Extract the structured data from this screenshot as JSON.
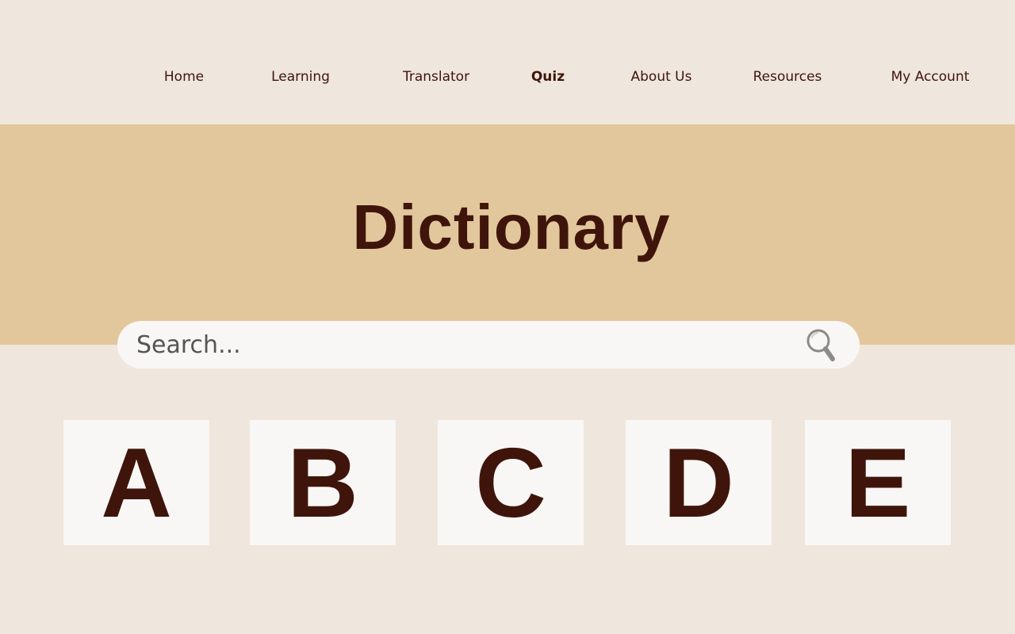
{
  "nav": {
    "items": [
      {
        "label": "Home",
        "active": false
      },
      {
        "label": "Learning",
        "active": false
      },
      {
        "label": "Translator",
        "active": false
      },
      {
        "label": "Quiz",
        "active": true
      },
      {
        "label": "About Us",
        "active": false
      },
      {
        "label": "Resources",
        "active": false
      },
      {
        "label": "My Account",
        "active": false
      }
    ]
  },
  "hero": {
    "title": "Dictionary"
  },
  "search": {
    "placeholder": "Search...",
    "value": "",
    "icon": "magnifier-icon"
  },
  "letters": [
    "A",
    "B",
    "C",
    "D",
    "E"
  ],
  "colors": {
    "page_background": "#efe6dd",
    "hero_background": "#e2c79c",
    "text": "#3f150b",
    "card_background": "#f9f7f5"
  }
}
